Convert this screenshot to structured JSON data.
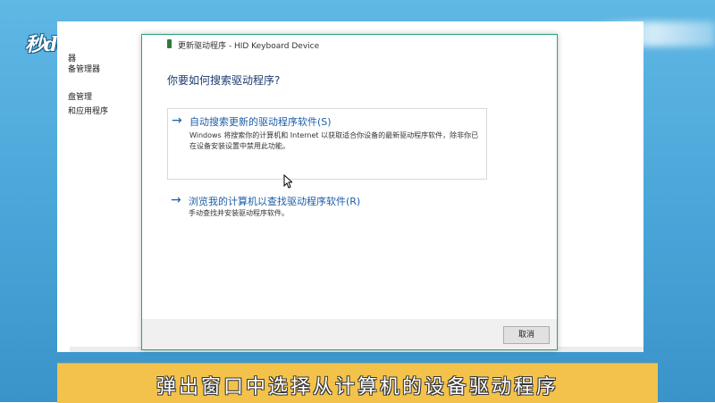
{
  "watermark": {
    "text": "秒dong视频"
  },
  "left_panel": {
    "items": [
      "器",
      "备管理器",
      "盘管理",
      "和应用程序"
    ]
  },
  "dialog": {
    "title": "更新驱动程序 - HID Keyboard Device",
    "heading": "你要如何搜索驱动程序?",
    "options": [
      {
        "arrow_icon": "arrow-right-icon",
        "title": "自动搜索更新的驱动程序软件(S)",
        "description": "Windows 将搜索你的计算机和 Internet 以获取适合你设备的最新驱动程序软件，除非你已在设备安装设置中禁用此功能。"
      },
      {
        "arrow_icon": "arrow-right-icon",
        "title": "浏览我的计算机以查找驱动程序软件(R)",
        "description": "手动查找并安装驱动程序软件。"
      }
    ],
    "cancel_label": "取消"
  },
  "subtitle": {
    "text": "弹出窗口中选择从计算机的设备驱动程序"
  },
  "colors": {
    "accent_border": "#2aa37a",
    "link_blue": "#1c5ea8",
    "subtitle_bg": "#f3c24a",
    "background_blue": "#4aa6d9"
  }
}
